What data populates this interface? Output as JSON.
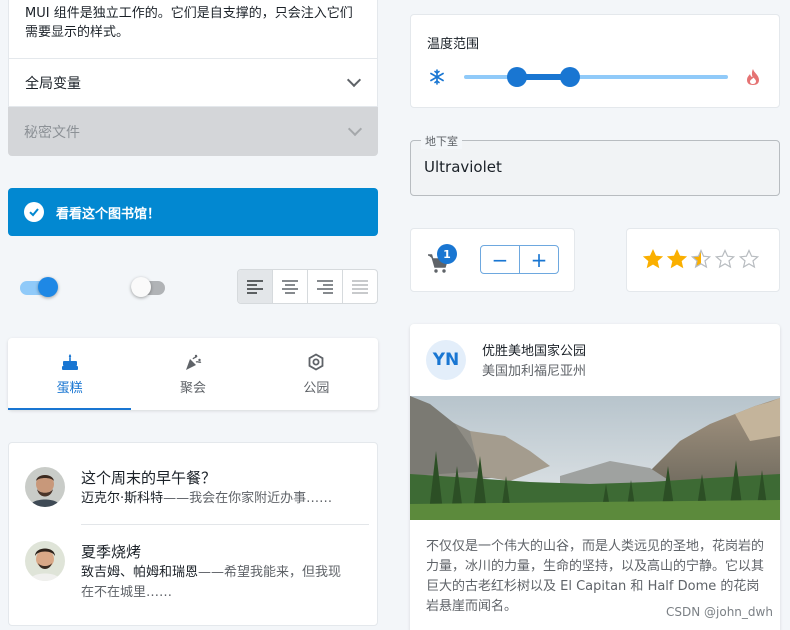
{
  "accordion": {
    "intro_text": "MUI 组件是独立工作的。它们是自支撑的，只会注入它们需要显示的样式。",
    "global_label": "全局变量",
    "secret_label": "秘密文件"
  },
  "alert": {
    "message": "看看这个图书馆！"
  },
  "switches": [
    {
      "checked": true
    },
    {
      "checked": false
    }
  ],
  "toggle_group": {
    "selected": "left",
    "disabled": "justify"
  },
  "tabs": [
    {
      "label": "蛋糕",
      "icon": "cake-icon",
      "active": true
    },
    {
      "label": "聚会",
      "icon": "celebration-icon",
      "active": false
    },
    {
      "label": "公园",
      "icon": "park-icon",
      "active": false
    }
  ],
  "list": [
    {
      "title": "这个周末的早午餐？",
      "author": "迈克尔·斯科特",
      "preview": "——我会在你家附近办事……"
    },
    {
      "title": "夏季烧烤",
      "author": "致吉姆、帕姆和瑞恩",
      "preview": "——希望我能来，但我现在不在城里……"
    }
  ],
  "slider": {
    "label": "温度范围",
    "min": 0,
    "max": 100,
    "range": [
      20,
      40
    ]
  },
  "text_field": {
    "label": "地下室",
    "value": "Ultraviolet"
  },
  "cart": {
    "badge": "1",
    "minus": "−",
    "plus": "+"
  },
  "rating": {
    "value": 2.5,
    "max": 5
  },
  "media_card": {
    "avatar": "YN",
    "title": "优胜美地国家公园",
    "subtitle": "美国加利福尼亚州",
    "body": "不仅仅是一个伟大的山谷，而是人类远见的圣地，花岗岩的力量，冰川的力量，生命的坚持，以及高山的宁静。它以其巨大的古老红杉树以及 El Capitan 和 Half Dome 的花岗岩悬崖而闻名。"
  },
  "watermark": "CSDN @john_dwh",
  "colors": {
    "primary": "#1976d2",
    "alert": "#0288d1",
    "star": "#faaf00",
    "fire": "#e57373"
  }
}
